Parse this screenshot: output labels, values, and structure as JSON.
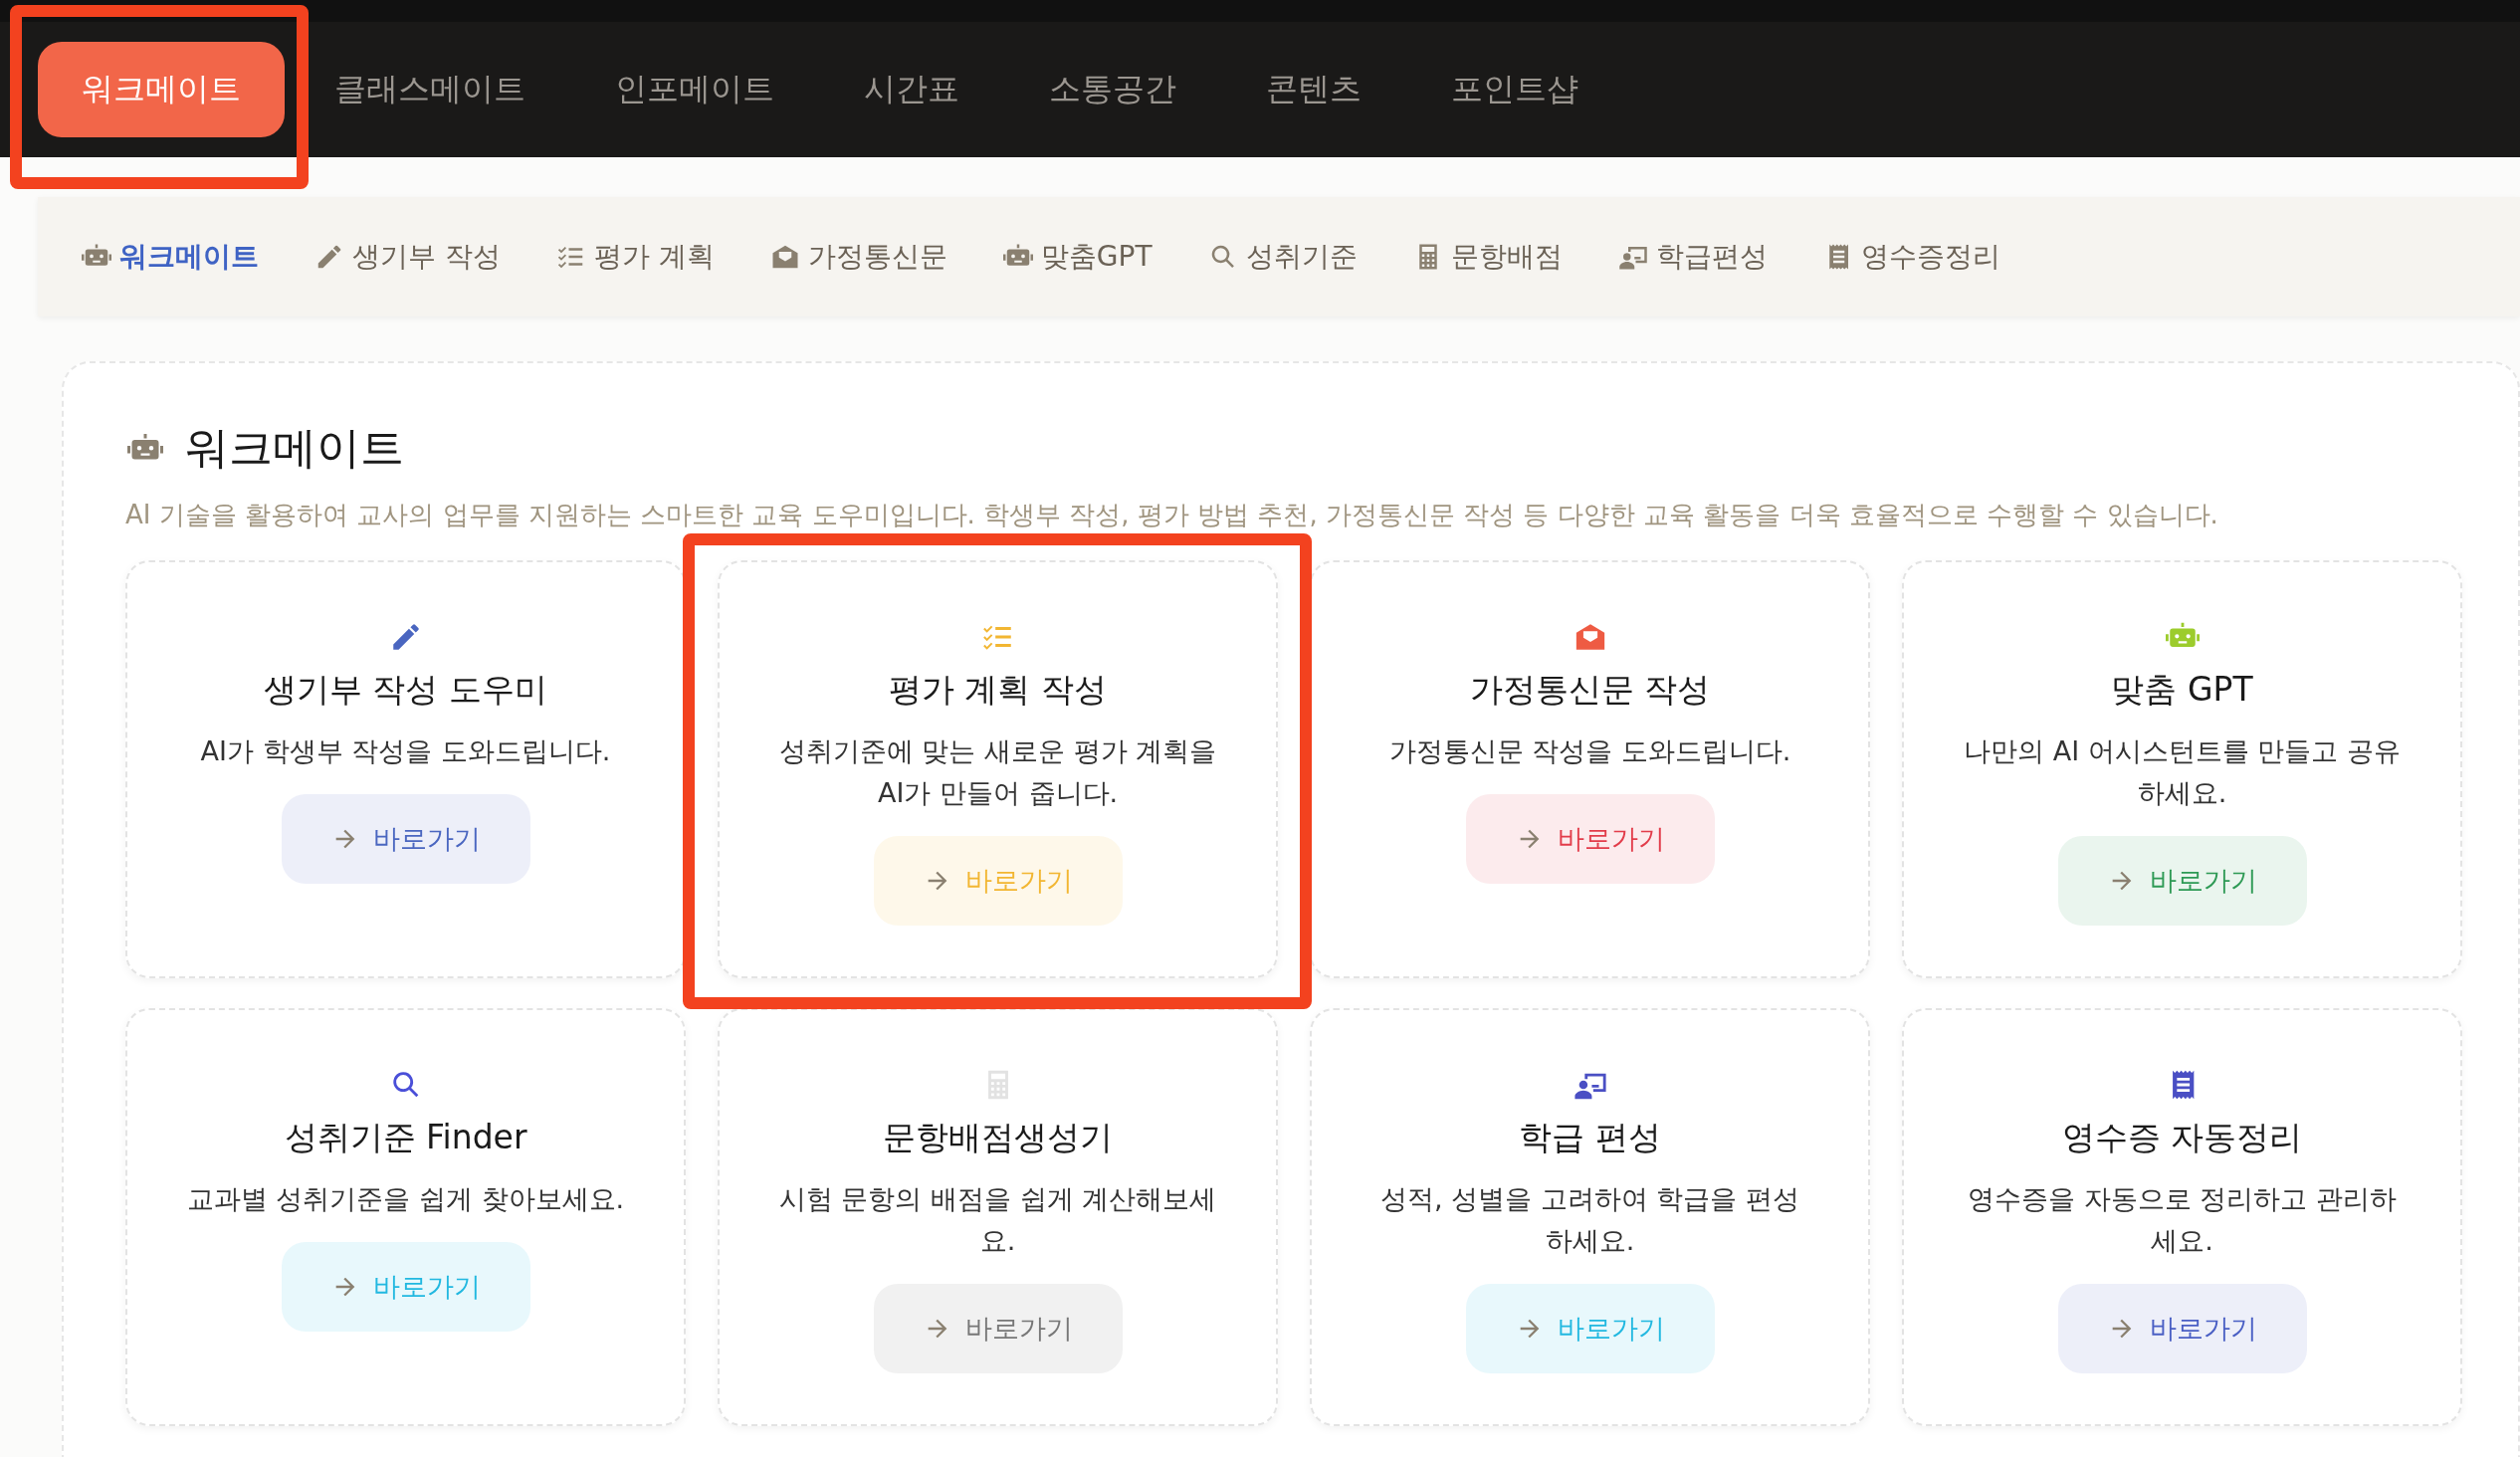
{
  "top_nav": [
    {
      "label": "워크메이트",
      "selected": true
    },
    {
      "label": "클래스메이트",
      "selected": false
    },
    {
      "label": "인포메이트",
      "selected": false
    },
    {
      "label": "시간표",
      "selected": false
    },
    {
      "label": "소통공간",
      "selected": false
    },
    {
      "label": "콘텐츠",
      "selected": false
    },
    {
      "label": "포인트샵",
      "selected": false
    }
  ],
  "sub_nav": [
    {
      "label": "워크메이트",
      "kind": "robot",
      "selected": true
    },
    {
      "label": "생기부 작성",
      "kind": "pencil",
      "selected": false
    },
    {
      "label": "평가 계획",
      "kind": "checklist",
      "selected": false
    },
    {
      "label": "가정통신문",
      "kind": "envelope",
      "selected": false
    },
    {
      "label": "맞춤GPT",
      "kind": "robot",
      "selected": false
    },
    {
      "label": "성취기준",
      "kind": "search",
      "selected": false
    },
    {
      "label": "문항배점",
      "kind": "calculator",
      "selected": false
    },
    {
      "label": "학급편성",
      "kind": "teacher",
      "selected": false
    },
    {
      "label": "영수증정리",
      "kind": "receipt",
      "selected": false
    }
  ],
  "section": {
    "title": "워크메이트",
    "description": "AI 기술을 활용하여 교사의 업무를 지원하는 스마트한 교육 도우미입니다. 학생부 작성, 평가 방법 추천, 가정통신문 작성 등 다양한 교육 활동을 더욱 효율적으로 수행할 수 있습니다."
  },
  "cards": [
    {
      "kind": "pencil",
      "color": "#4a66c0",
      "title": "생기부 작성 도우미",
      "description": "AI가 학생부 작성을 도와드립니다.",
      "button": "바로가기"
    },
    {
      "kind": "checklist",
      "color": "#f2b632",
      "title": "평가 계획 작성",
      "description": "성취기준에 맞는 새로운 평가 계획을 AI가 만들어 줍니다.",
      "button": "바로가기"
    },
    {
      "kind": "envelope",
      "color": "#e23c4a",
      "title": "가정통신문 작성",
      "description": "가정통신문 작성을 도와드립니다.",
      "button": "바로가기"
    },
    {
      "kind": "robot",
      "color": "#2e9a55",
      "title": "맞춤 GPT",
      "description": "나만의 AI 어시스턴트를 만들고 공유하세요.",
      "button": "바로가기"
    },
    {
      "kind": "search",
      "color": "#22b8e0",
      "title": "성취기준 Finder",
      "description": "교과별 성취기준을 쉽게 찾아보세요.",
      "button": "바로가기"
    },
    {
      "kind": "calculator",
      "color": "#777777",
      "title": "문항배점생성기",
      "description": "시험 문항의 배점을 쉽게 계산해보세요.",
      "button": "바로가기"
    },
    {
      "kind": "teacher",
      "color": "#22b8e0",
      "title": "학급 편성",
      "description": "성적, 성별을 고려하여 학급을 편성하세요.",
      "button": "바로가기"
    },
    {
      "kind": "receipt",
      "color": "#4a5fc4",
      "title": "영수증 자동정리",
      "description": "영수증을 자동으로 정리하고 관리하세요.",
      "button": "바로가기"
    }
  ]
}
